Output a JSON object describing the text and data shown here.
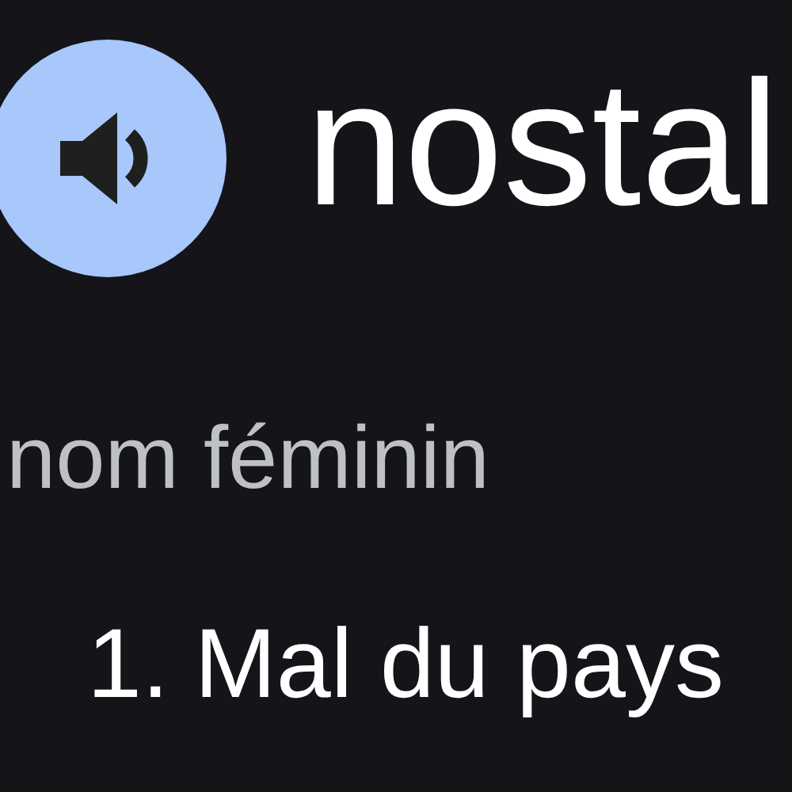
{
  "headword": "nostal",
  "part_of_speech": "nom féminin",
  "definitions": [
    {
      "number": "1.",
      "text": "Mal du pays"
    }
  ]
}
